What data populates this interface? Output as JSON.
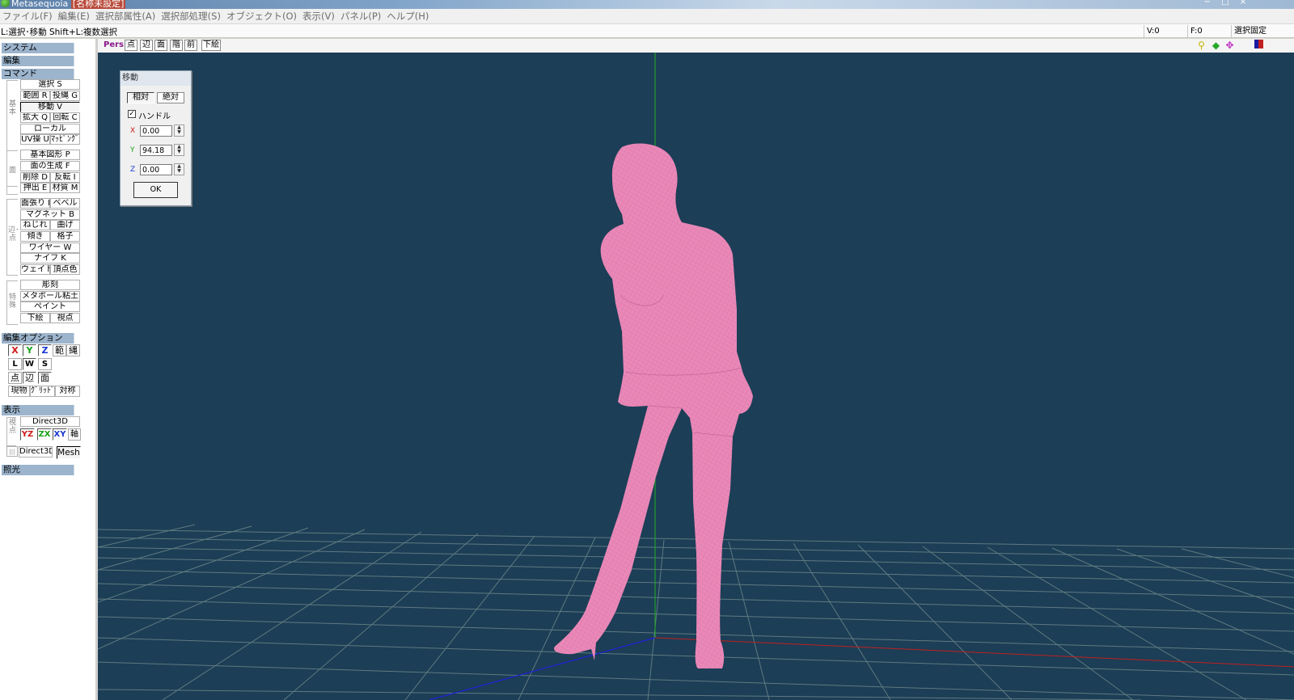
{
  "titlebar": {
    "app": "Metasequoia",
    "doc": "[名称未設定]",
    "buttons": [
      "−",
      "□",
      "×"
    ]
  },
  "menubar": {
    "items": [
      "ファイル(F)",
      "編集(E)",
      "選択部属性(A)",
      "選択部処理(S)",
      "オブジェクト(O)",
      "表示(V)",
      "パネル(P)",
      "ヘルプ(H)"
    ]
  },
  "statusbar": {
    "hint": "L:選択･移動  Shift+L:複数選択",
    "vertices": "V:0",
    "faces": "F:0",
    "selection_lock": "選択固定"
  },
  "panel": {
    "system": "システム",
    "edit": "編集",
    "command": "コマンド",
    "group_basic": "基本",
    "group_face": "面",
    "group_edge_vertex": "辺･点",
    "group_special": "特殊",
    "commands": {
      "select": "選択 S",
      "range": "範囲 R",
      "lasso": "投縄 G",
      "move": "移動 V",
      "scale": "拡大 Q",
      "rotate": "回転 C",
      "local": "ローカル",
      "uv": "UV操 U",
      "mapping": "ﾏｯﾋﾟﾝｸﾞ",
      "primitive": "基本図形 P",
      "face_gen": "面の生成 F",
      "delete": "削除 D",
      "flip": "反転 I",
      "extrude": "押出 E",
      "material": "材質 M",
      "face_dig": "面張り H",
      "bevel": "ベベル",
      "magnet": "マグネット B",
      "twist": "ねじれ",
      "bend": "曲げ",
      "tilt": "傾き",
      "lattice": "格子",
      "wire": "ワイヤー W",
      "knife": "ナイフ K",
      "weight": "ウェイト",
      "vertex_color": "頂点色",
      "sculpt": "彫刻",
      "metaball": "メタボール粘土",
      "paint": "ペイント",
      "underlay": "下絵",
      "viewpoint": "視点"
    },
    "edit_options": "編集オプション",
    "opt": {
      "x": "X",
      "y": "Y",
      "z": "Z",
      "range": "範",
      "lasso": "縄",
      "l": "L",
      "w": "W",
      "s": "S",
      "vertex": "点",
      "edge": "辺",
      "face": "面",
      "current": "現物",
      "grid": "ｸﾞﾘｯﾄﾞ",
      "symmetry": "対称"
    },
    "display": "表示",
    "group_view": "視点",
    "disp": {
      "direct3d": "Direct3D",
      "yz": "YZ",
      "zx": "ZX",
      "xy": "XY",
      "axis": "軸",
      "direct3d_small": "Direct3D",
      "mesh": "Mesh",
      "mini": "|||"
    },
    "lighting": "照光"
  },
  "viewport": {
    "mode": "Pers",
    "buttons": [
      "点",
      "辺",
      "面",
      "階",
      "前",
      "下絵"
    ],
    "nav_icons": [
      "zoom-icon",
      "rotate-icon",
      "pan-icon",
      "color-icon"
    ]
  },
  "move_dialog": {
    "title": "移動",
    "relative": "相対",
    "absolute": "絶対",
    "handle_label": "ハンドル",
    "handle_checked": true,
    "x_label": "X",
    "x_value": "0.00",
    "y_label": "Y",
    "y_value": "94.18",
    "z_label": "Z",
    "z_value": "0.00",
    "ok": "OK"
  },
  "colors": {
    "viewport_bg": "#1c3e56",
    "model": "#ea88b8",
    "grid": "#5f7a80",
    "axis_x": "#c02020",
    "axis_y": "#20b020",
    "axis_z": "#2020d8",
    "panel_header": "#9cb4cc"
  }
}
